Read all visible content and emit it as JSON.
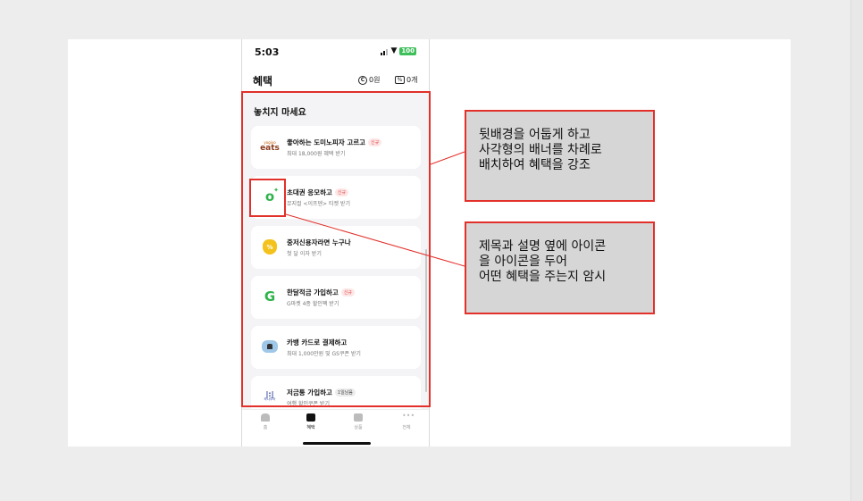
{
  "status_bar": {
    "time": "5:03",
    "battery": "100"
  },
  "app_bar": {
    "title": "혜택",
    "points_icon": "C",
    "points": "0원",
    "coupons": "0개"
  },
  "section_title": "놓치지 마세요",
  "cards": [
    {
      "icon": "eats",
      "icon_small": "yogiyo",
      "title": "좋아하는 도미노피자 고르고",
      "badge": "신규",
      "subtitle": "최대 18,000원 혜택 받기"
    },
    {
      "icon": "o",
      "title": "초대권 응모하고",
      "badge": "신규",
      "subtitle": "뮤지컬 <이프덴> 티켓 받기"
    },
    {
      "icon": "money-bag",
      "title": "중저신용자라면 누구나",
      "badge": "",
      "subtitle": "첫 달 이자 받기"
    },
    {
      "icon": "G",
      "title": "한달적금 가입하고",
      "badge": "신규",
      "subtitle": "G마켓 4종 할인팩 받기"
    },
    {
      "icon": "house",
      "title": "카뱅 카드로 결제하고",
      "badge": "",
      "subtitle": "최대 1,000만원 및 GS쿠폰 받기"
    },
    {
      "icon": "hana",
      "icon_small": "하나투어",
      "title": "저금통 가입하고",
      "badge": "1일남음",
      "subtitle": "여행 할인쿠폰 받기"
    }
  ],
  "tabs": [
    {
      "label": "홈"
    },
    {
      "label": "혜택"
    },
    {
      "label": "상품"
    },
    {
      "label": "전체"
    }
  ],
  "annotations": [
    {
      "text": "뒷배경을 어둡게 하고\n사각형의 배너를 차례로\n배치하여 혜택을 강조"
    },
    {
      "text": "제목과 설명 옆에 아이콘\n을 아이콘을 두어\n어떤 혜택을 주는지 암시"
    }
  ],
  "colors": {
    "highlight": "#e2302a",
    "note_bg": "#d6d6d6",
    "badge_red": "#e24a4a",
    "green": "#2fb34a"
  }
}
